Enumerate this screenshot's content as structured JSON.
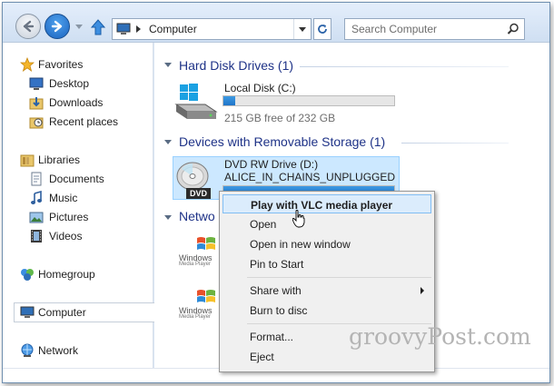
{
  "toolbar": {
    "address_path": "Computer",
    "search_placeholder": "Search Computer"
  },
  "nav": {
    "favorites": "Favorites",
    "desktop": "Desktop",
    "downloads": "Downloads",
    "recent": "Recent places",
    "libraries": "Libraries",
    "documents": "Documents",
    "music": "Music",
    "pictures": "Pictures",
    "videos": "Videos",
    "homegroup": "Homegroup",
    "computer": "Computer",
    "network": "Network"
  },
  "groups": {
    "hdd": "Hard Disk Drives (1)",
    "removable": "Devices with Removable Storage (1)",
    "network_partial": "Netwo"
  },
  "local_disk": {
    "name": "Local Disk (C:)",
    "free": "215 GB free of 232 GB",
    "used_fraction": 0.07
  },
  "dvd": {
    "name": "DVD RW Drive (D:)",
    "label": "ALICE_IN_CHAINS_UNPLUGGED",
    "used_fraction": 1.0,
    "badge": "DVD"
  },
  "network_items": [
    {
      "line1": "Windows",
      "line2": "Media Player"
    },
    {
      "line1": "Windows",
      "line2": "Media Player"
    }
  ],
  "context_menu": {
    "items": [
      {
        "label": "Play with VLC media player",
        "bold": true,
        "highlighted": true
      },
      {
        "label": "Open"
      },
      {
        "label": "Open in new window"
      },
      {
        "label": "Pin to Start"
      },
      {
        "label": "Share with",
        "submenu": true
      },
      {
        "label": "Burn to disc"
      },
      {
        "label": "Format..."
      },
      {
        "label": "Eject"
      }
    ]
  },
  "watermark": "groovyPost.com",
  "colors": {
    "accent": "#1f74c8",
    "group_header": "#1e3287",
    "selection": "#cce8ff"
  }
}
